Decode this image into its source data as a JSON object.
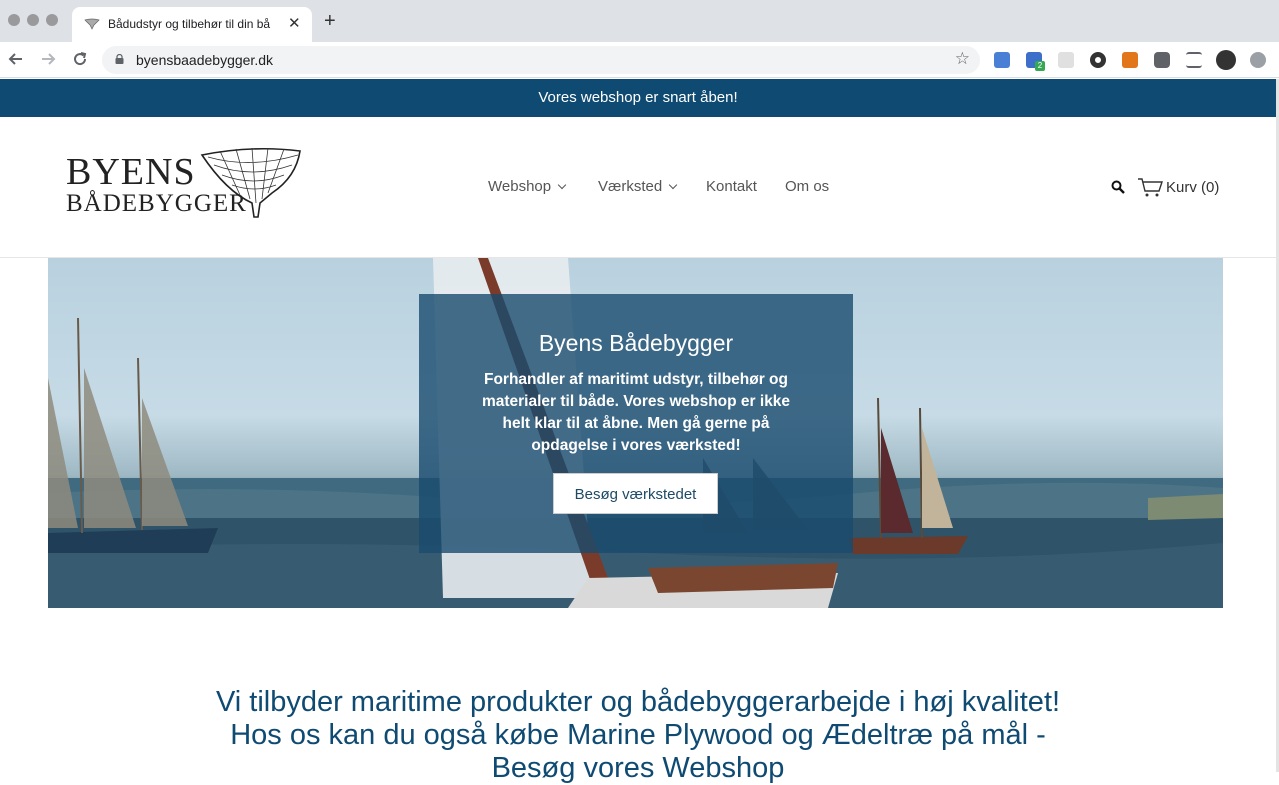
{
  "browser": {
    "tab_title": "Bådudstyr og tilbehør til din bå",
    "tab_close": "✕",
    "new_tab": "+",
    "url": "byensbaadebygger.dk",
    "ext_badge": "2"
  },
  "announcement": "Vores webshop er snart åben!",
  "logo": {
    "line1": "BYENS",
    "line2": "BÅDEBYGGER"
  },
  "nav": {
    "webshop": "Webshop",
    "vaerksted": "Værksted",
    "kontakt": "Kontakt",
    "om_os": "Om os",
    "cart": "Kurv (0)"
  },
  "hero": {
    "title": "Byens Bådebygger",
    "text": "Forhandler af maritimt udstyr, tilbehør og materialer til både. Vores webshop er ikke helt klar til at åbne. Men gå gerne på opdagelse i vores værksted!",
    "button": "Besøg værkstedet"
  },
  "headline": "Vi tilbyder maritime produkter og bådebyggerarbejde i høj kvalitet! Hos os kan du også købe Marine Plywood og Ædeltræ på mål - Besøg vores Webshop",
  "colors": {
    "brand": "#0e4a72"
  }
}
